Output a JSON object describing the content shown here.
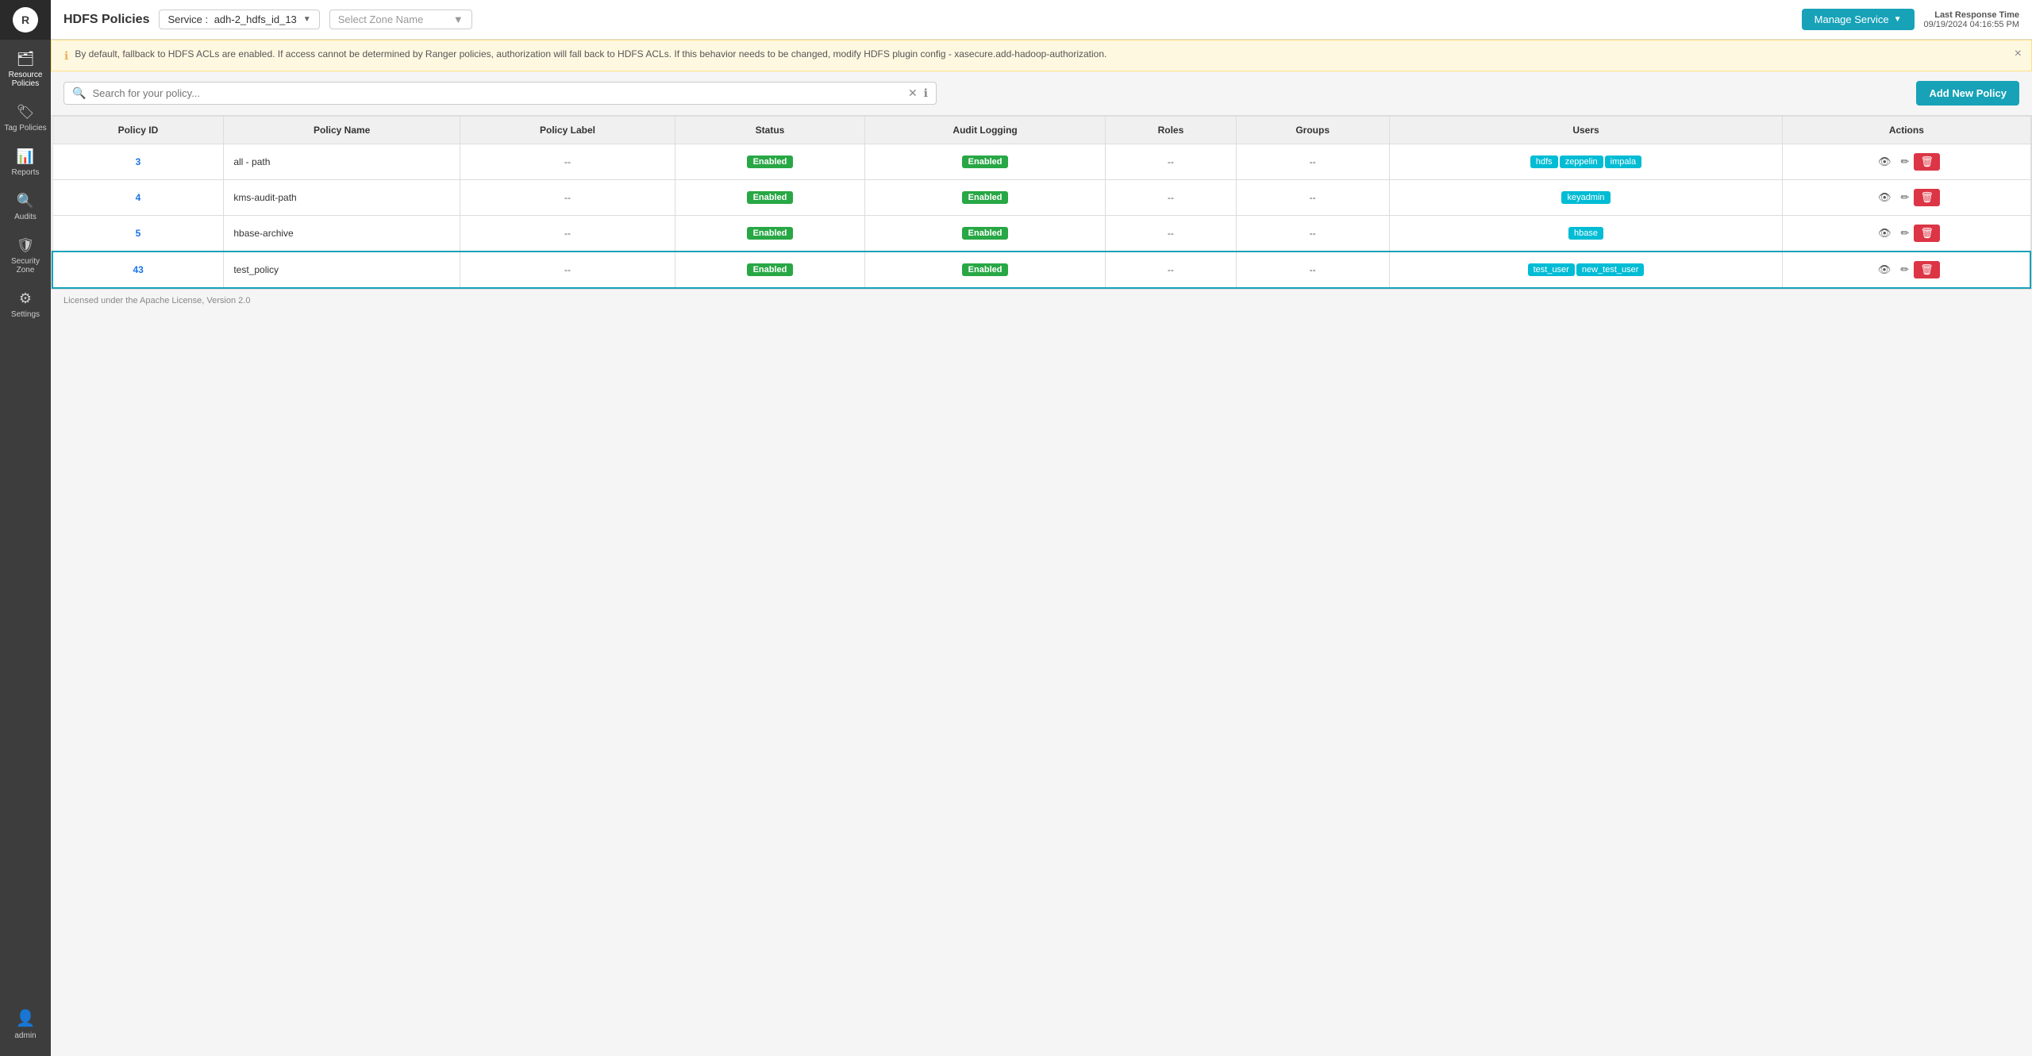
{
  "app": {
    "logo_text": "R",
    "title": "HDFS Policies"
  },
  "sidebar": {
    "items": [
      {
        "id": "resource-policies",
        "label": "Resource Policies",
        "icon": "🗂"
      },
      {
        "id": "tag-policies",
        "label": "Tag Policies",
        "icon": "🏷"
      },
      {
        "id": "reports",
        "label": "Reports",
        "icon": "📊"
      },
      {
        "id": "audits",
        "label": "Audits",
        "icon": "🔍"
      },
      {
        "id": "security-zone",
        "label": "Security Zone",
        "icon": "🛡"
      },
      {
        "id": "settings",
        "label": "Settings",
        "icon": "⚙"
      }
    ],
    "user": {
      "label": "admin",
      "icon": "👤"
    }
  },
  "header": {
    "title": "HDFS Policies",
    "service_label": "Service :",
    "service_value": "adh-2_hdfs_id_13",
    "zone_placeholder": "Select Zone Name",
    "manage_service_label": "Manage Service",
    "last_response_label": "Last Response Time",
    "last_response_value": "09/19/2024 04:16:55 PM"
  },
  "alert": {
    "message": "By default, fallback to HDFS ACLs are enabled. If access cannot be determined by Ranger policies, authorization will fall back to HDFS ACLs. If this behavior needs to be changed, modify HDFS plugin config - xasecure.add-hadoop-authorization."
  },
  "search": {
    "placeholder": "Search for your policy..."
  },
  "toolbar": {
    "add_button_label": "Add New Policy"
  },
  "table": {
    "columns": [
      "Policy ID",
      "Policy Name",
      "Policy Label",
      "Status",
      "Audit Logging",
      "Roles",
      "Groups",
      "Users",
      "Actions"
    ],
    "rows": [
      {
        "id": "3",
        "name": "all - path",
        "label": "--",
        "status": "Enabled",
        "audit_logging": "Enabled",
        "roles": "--",
        "groups": "--",
        "users": [
          "hdfs",
          "zeppelin",
          "impala"
        ],
        "highlighted": false
      },
      {
        "id": "4",
        "name": "kms-audit-path",
        "label": "--",
        "status": "Enabled",
        "audit_logging": "Enabled",
        "roles": "--",
        "groups": "--",
        "users": [
          "keyadmin"
        ],
        "highlighted": false
      },
      {
        "id": "5",
        "name": "hbase-archive",
        "label": "--",
        "status": "Enabled",
        "audit_logging": "Enabled",
        "roles": "--",
        "groups": "--",
        "users": [
          "hbase"
        ],
        "highlighted": false
      },
      {
        "id": "43",
        "name": "test_policy",
        "label": "--",
        "status": "Enabled",
        "audit_logging": "Enabled",
        "roles": "--",
        "groups": "--",
        "users": [
          "test_user",
          "new_test_user"
        ],
        "highlighted": true
      }
    ]
  },
  "footer": {
    "license_text": "Licensed under the Apache License, Version 2.0"
  },
  "colors": {
    "enabled_badge": "#28a745",
    "user_tag": "#00bcd4",
    "delete_btn": "#dc3545",
    "manage_btn": "#17a2b8",
    "add_btn": "#17a2b8",
    "highlight_border": "#17a2b8"
  }
}
